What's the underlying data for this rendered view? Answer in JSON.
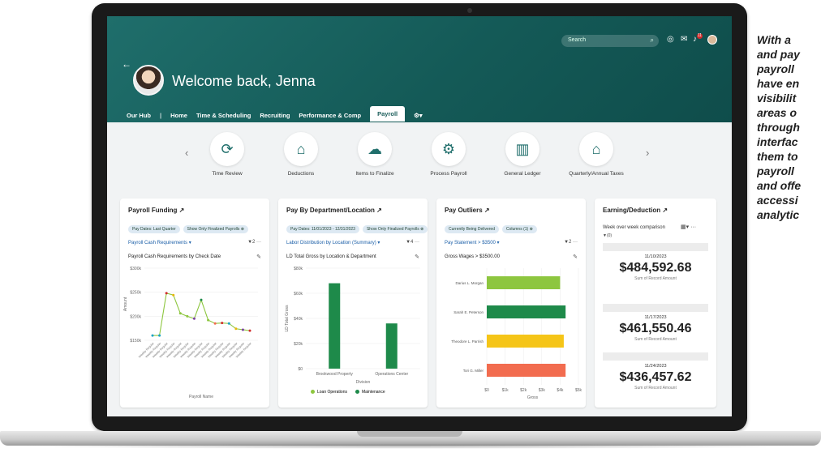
{
  "header": {
    "welcome": "Welcome back, Jenna",
    "search_placeholder": "Search",
    "notification_count": "11",
    "nav": [
      "Our Hub",
      "|",
      "Home",
      "Time & Scheduling",
      "Recruiting",
      "Performance & Comp",
      "Payroll",
      "⚙▾"
    ]
  },
  "carousel": [
    "Time Review",
    "Deductions",
    "Items to Finalize",
    "Process Payroll",
    "General Ledger",
    "Quarterly/Annual Taxes"
  ],
  "cards": {
    "funding": {
      "title": "Payroll Funding ↗",
      "chips": [
        "Pay Dates: Last Quarter",
        "Show Only Finalized Payrolls ⊗"
      ],
      "selector": "Payroll Cash Requirements ▾",
      "filter": "▼2  ···",
      "subtitle": "Payroll Cash Requirements by Check Date"
    },
    "department": {
      "title": "Pay By Department/Location ↗",
      "chips": [
        "Pay Dates: 11/01/2023 - 12/31/2023",
        "Show Only Finalized Payrolls ⊗"
      ],
      "selector": "Labor Distribution by Location (Summary) ▾",
      "filter": "▼4  ···",
      "subtitle": "LD Total Gross by Location & Department"
    },
    "outliers": {
      "title": "Pay Outliers ↗",
      "chips": [
        "Currently Being Delivered",
        "Columns (1) ⊗"
      ],
      "selector": "Pay Statement > $3500 ▾",
      "filter": "▼2  ···",
      "subtitle": "Gross Wages > $3500.00"
    },
    "earning": {
      "title": "Earning/Deduction ↗",
      "comparison": "Week over week comparison",
      "filter": "▼(0)",
      "entries": [
        {
          "date": "11/10/2023",
          "amount": "$484,592.68",
          "label": "Sum of Record Amount"
        },
        {
          "date": "11/17/2023",
          "amount": "$461,550.46",
          "label": "Sum of Record Amount"
        },
        {
          "date": "11/24/2023",
          "amount": "$436,457.62",
          "label": "Sum of Record Amount"
        }
      ]
    }
  },
  "side_text": [
    "With a",
    "and pay",
    "payroll",
    "have en",
    "visibilit",
    "areas o",
    "through",
    "interfac",
    "them to",
    "payroll",
    "and offe",
    "accessi",
    "analytic"
  ],
  "chart_data": [
    {
      "type": "line",
      "subtitle": "Payroll Cash Requirements by Check Date",
      "xlabel": "Payroll Name",
      "ylabel": "Amount",
      "ylim": [
        150000,
        300000
      ],
      "yticks": [
        "$300k",
        "$250k",
        "$200k",
        "$150k"
      ],
      "x": [
        "1",
        "2",
        "3",
        "4",
        "5",
        "6",
        "7",
        "8",
        "9",
        "10",
        "11",
        "12",
        "13",
        "14",
        "15"
      ],
      "values": [
        160000,
        160000,
        248000,
        244000,
        206000,
        200000,
        195000,
        234000,
        192000,
        185000,
        186000,
        185000,
        174000,
        172000,
        170000
      ]
    },
    {
      "type": "bar",
      "subtitle": "LD Total Gross by Location & Department",
      "xlabel": "Division",
      "ylabel": "LD Total Gross",
      "ylim": [
        0,
        80000
      ],
      "yticks": [
        "$80k",
        "$60k",
        "$40k",
        "$20k",
        "$0"
      ],
      "categories": [
        "Brookwood Property",
        "Operations Center"
      ],
      "series": [
        {
          "name": "Loan Operations",
          "color": "#8dc63f",
          "values": [
            0,
            0
          ]
        },
        {
          "name": "Maintenance",
          "color": "#1e8a4a",
          "values": [
            68000,
            36000
          ]
        }
      ]
    },
    {
      "type": "bar",
      "orientation": "horizontal",
      "subtitle": "Gross Wages > $3500.00",
      "xlabel": "Gross",
      "xlim": [
        0,
        5000
      ],
      "xticks": [
        "$0",
        "$1k",
        "$2k",
        "$3k",
        "$4k",
        "$5k"
      ],
      "categories": [
        "Darius L. Morgan",
        "Sarah E. Peterson",
        "Theodore L. Parrish",
        "Tori G. Miller"
      ],
      "values": [
        4000,
        4300,
        4200,
        4300
      ],
      "colors": [
        "#8dc63f",
        "#1e8a4a",
        "#f5c518",
        "#f26c4f"
      ]
    }
  ]
}
